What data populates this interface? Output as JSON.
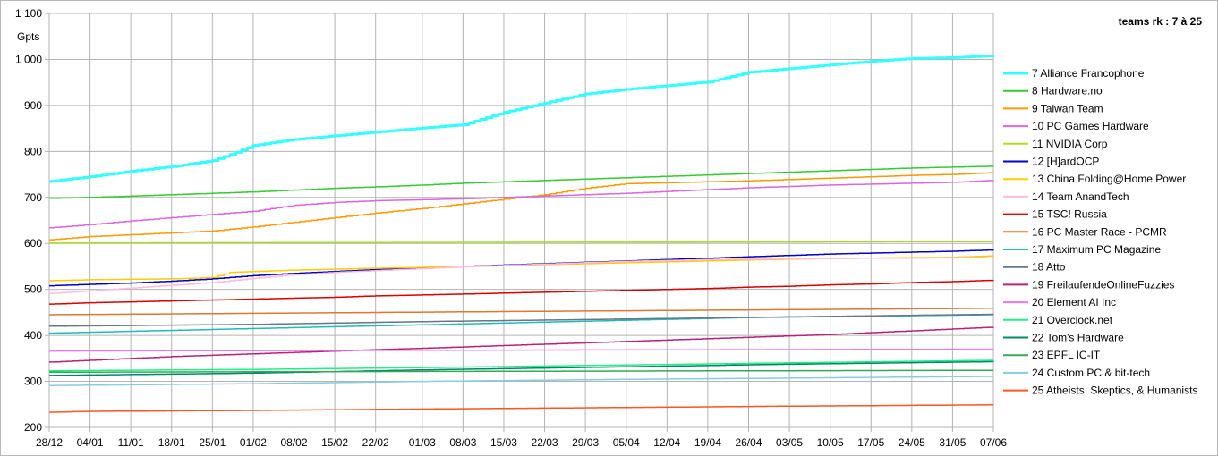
{
  "chart_data": {
    "type": "line",
    "ylabel": "Gpts",
    "legend_title": "teams rk : 7 à 25",
    "legend_position": "right",
    "grid": true,
    "ylim": [
      200,
      1100
    ],
    "yticks": [
      200,
      300,
      400,
      500,
      600,
      700,
      800,
      900,
      1000,
      1100
    ],
    "ytick_labels": [
      "200",
      "300",
      "400",
      "500",
      "600",
      "700",
      "800",
      "900",
      "1 000",
      "1 100"
    ],
    "xlim": [
      "2019-12-28",
      "2020-06-07"
    ],
    "xticks": [
      "2019-12-28",
      "2020-01-04",
      "2020-01-11",
      "2020-01-18",
      "2020-01-25",
      "2020-02-01",
      "2020-02-08",
      "2020-02-15",
      "2020-02-22",
      "2020-03-01",
      "2020-03-08",
      "2020-03-15",
      "2020-03-22",
      "2020-03-29",
      "2020-04-05",
      "2020-04-12",
      "2020-04-19",
      "2020-04-26",
      "2020-05-03",
      "2020-05-10",
      "2020-05-17",
      "2020-05-24",
      "2020-05-31",
      "2020-06-07"
    ],
    "xtick_labels": [
      "28/12",
      "04/01",
      "11/01",
      "18/01",
      "25/01",
      "01/02",
      "08/02",
      "15/02",
      "22/02",
      "01/03",
      "08/03",
      "15/03",
      "22/03",
      "29/03",
      "05/04",
      "12/04",
      "19/04",
      "26/04",
      "03/05",
      "10/05",
      "17/05",
      "24/05",
      "31/05",
      "07/06"
    ],
    "series": [
      {
        "name": "7 Alliance Francophone",
        "color": "#33ffff",
        "x": [
          "2019-12-28",
          "2020-01-04",
          "2020-01-11",
          "2020-01-18",
          "2020-01-25",
          "2020-01-29",
          "2020-02-01",
          "2020-02-08",
          "2020-02-15",
          "2020-02-22",
          "2020-03-01",
          "2020-03-08",
          "2020-03-15",
          "2020-03-22",
          "2020-03-29",
          "2020-04-05",
          "2020-04-12",
          "2020-04-19",
          "2020-04-26",
          "2020-05-03",
          "2020-05-10",
          "2020-05-17",
          "2020-05-24",
          "2020-05-31",
          "2020-06-07"
        ],
        "values": [
          735,
          745,
          757,
          767,
          780,
          798,
          813,
          826,
          834,
          842,
          851,
          858,
          885,
          905,
          925,
          935,
          943,
          951,
          972,
          980,
          988,
          996,
          1002,
          1004,
          1008
        ]
      },
      {
        "name": "8 Hardware.no",
        "color": "#33cc33",
        "x": [
          "2019-12-28",
          "2020-01-04",
          "2020-01-11",
          "2020-01-18",
          "2020-01-25",
          "2020-02-01",
          "2020-02-08",
          "2020-02-15",
          "2020-02-22",
          "2020-03-01",
          "2020-03-08",
          "2020-03-15",
          "2020-03-22",
          "2020-03-29",
          "2020-04-05",
          "2020-04-12",
          "2020-04-19",
          "2020-04-26",
          "2020-05-03",
          "2020-05-10",
          "2020-05-17",
          "2020-05-24",
          "2020-05-31",
          "2020-06-07"
        ],
        "values": [
          698,
          700,
          703,
          706,
          709,
          712,
          716,
          720,
          723,
          727,
          731,
          734,
          737,
          740,
          743,
          746,
          749,
          752,
          755,
          758,
          761,
          764,
          766,
          768
        ]
      },
      {
        "name": "9 Taiwan Team",
        "color": "#ff9900",
        "x": [
          "2019-12-28",
          "2020-01-04",
          "2020-01-11",
          "2020-01-18",
          "2020-01-25",
          "2020-02-01",
          "2020-02-08",
          "2020-02-15",
          "2020-02-22",
          "2020-03-01",
          "2020-03-08",
          "2020-03-15",
          "2020-03-22",
          "2020-03-29",
          "2020-04-05",
          "2020-04-12",
          "2020-04-19",
          "2020-04-26",
          "2020-05-03",
          "2020-05-10",
          "2020-05-17",
          "2020-05-24",
          "2020-05-31",
          "2020-06-07"
        ],
        "values": [
          608,
          615,
          619,
          623,
          627,
          636,
          646,
          656,
          666,
          676,
          686,
          696,
          706,
          720,
          730,
          732,
          734,
          736,
          739,
          742,
          745,
          748,
          750,
          754
        ]
      },
      {
        "name": "10 PC Games Hardware",
        "color": "#dd66dd",
        "x": [
          "2019-12-28",
          "2020-01-04",
          "2020-01-11",
          "2020-01-18",
          "2020-01-25",
          "2020-02-01",
          "2020-02-08",
          "2020-02-15",
          "2020-02-22",
          "2020-03-01",
          "2020-03-08",
          "2020-03-15",
          "2020-03-22",
          "2020-03-29",
          "2020-04-05",
          "2020-04-12",
          "2020-04-19",
          "2020-04-26",
          "2020-05-03",
          "2020-05-10",
          "2020-05-17",
          "2020-05-24",
          "2020-05-31",
          "2020-06-07"
        ],
        "values": [
          634,
          641,
          649,
          656,
          663,
          670,
          683,
          689,
          693,
          695,
          697,
          700,
          703,
          706,
          709,
          713,
          717,
          721,
          724,
          727,
          729,
          731,
          733,
          737
        ]
      },
      {
        "name": "11 NVIDIA Corp",
        "color": "#aadd22",
        "x": [
          "2019-12-28",
          "2020-06-07"
        ],
        "values": [
          601,
          604
        ]
      },
      {
        "name": "12 [H]ardOCP",
        "color": "#0000cc",
        "x": [
          "2019-12-28",
          "2020-01-04",
          "2020-01-11",
          "2020-01-18",
          "2020-01-25",
          "2020-02-01",
          "2020-02-08",
          "2020-02-15",
          "2020-02-22",
          "2020-03-01",
          "2020-03-08",
          "2020-03-15",
          "2020-03-22",
          "2020-03-29",
          "2020-04-05",
          "2020-04-12",
          "2020-04-19",
          "2020-04-26",
          "2020-05-03",
          "2020-05-10",
          "2020-05-17",
          "2020-05-24",
          "2020-05-31",
          "2020-06-07"
        ],
        "values": [
          508,
          511,
          514,
          518,
          523,
          530,
          535,
          539,
          543,
          547,
          550,
          553,
          556,
          559,
          562,
          565,
          568,
          571,
          574,
          577,
          579,
          581,
          583,
          586
        ]
      },
      {
        "name": "13 China Folding@Home Power",
        "color": "#ffcc00",
        "x": [
          "2019-12-28",
          "2020-01-04",
          "2020-01-11",
          "2020-01-18",
          "2020-01-21",
          "2020-01-25",
          "2020-01-28",
          "2020-02-01",
          "2020-02-08",
          "2020-02-15",
          "2020-02-22",
          "2020-03-01",
          "2020-03-08",
          "2020-03-15",
          "2020-03-22",
          "2020-03-29",
          "2020-04-05",
          "2020-04-12",
          "2020-04-19",
          "2020-04-26",
          "2020-05-03",
          "2020-05-10",
          "2020-05-17",
          "2020-05-24",
          "2020-05-31",
          "2020-06-07"
        ],
        "values": [
          519,
          521,
          522,
          523,
          524,
          526,
          537,
          539,
          542,
          544,
          546,
          548,
          550,
          552,
          554,
          556,
          558,
          560,
          562,
          564,
          566,
          567,
          568,
          569,
          570,
          573
        ]
      },
      {
        "name": "14 Team AnandTech",
        "color": "#ffbbdd",
        "x": [
          "2019-12-28",
          "2020-01-04",
          "2020-01-11",
          "2020-01-18",
          "2020-01-25",
          "2020-02-01",
          "2020-02-08",
          "2020-02-15",
          "2020-02-22",
          "2020-03-01",
          "2020-03-08",
          "2020-03-15",
          "2020-03-22",
          "2020-03-29",
          "2020-04-05",
          "2020-04-12",
          "2020-04-19",
          "2020-04-26",
          "2020-05-03",
          "2020-05-10",
          "2020-05-17",
          "2020-05-24",
          "2020-05-31",
          "2020-06-07"
        ],
        "values": [
          491,
          497,
          503,
          509,
          515,
          524,
          532,
          537,
          541,
          545,
          549,
          552,
          555,
          558,
          561,
          563,
          565,
          566,
          567,
          567,
          568,
          568,
          569,
          569
        ]
      },
      {
        "name": "15 TSC! Russia",
        "color": "#dd0000",
        "x": [
          "2019-12-28",
          "2020-01-04",
          "2020-01-11",
          "2020-01-18",
          "2020-01-25",
          "2020-02-01",
          "2020-02-08",
          "2020-02-15",
          "2020-02-22",
          "2020-03-01",
          "2020-03-08",
          "2020-03-15",
          "2020-03-22",
          "2020-03-29",
          "2020-04-05",
          "2020-04-12",
          "2020-04-19",
          "2020-04-26",
          "2020-05-03",
          "2020-05-10",
          "2020-05-17",
          "2020-05-24",
          "2020-05-31",
          "2020-06-07"
        ],
        "values": [
          468,
          471,
          473,
          475,
          477,
          479,
          481,
          483,
          486,
          488,
          490,
          492,
          494,
          496,
          498,
          500,
          502,
          505,
          507,
          510,
          512,
          515,
          517,
          520
        ]
      },
      {
        "name": "16 PC Master Race - PCMR",
        "color": "#dd7733",
        "x": [
          "2019-12-28",
          "2020-06-07"
        ],
        "values": [
          445,
          459
        ]
      },
      {
        "name": "17 Maximum PC Magazine",
        "color": "#22bbbb",
        "x": [
          "2019-12-28",
          "2020-01-04",
          "2020-01-11",
          "2020-01-18",
          "2020-01-25",
          "2020-02-01",
          "2020-02-08",
          "2020-02-15",
          "2020-02-22",
          "2020-03-01",
          "2020-03-08",
          "2020-03-15",
          "2020-03-22",
          "2020-03-29",
          "2020-04-05",
          "2020-04-12",
          "2020-04-19",
          "2020-04-26",
          "2020-05-03",
          "2020-05-10",
          "2020-05-17",
          "2020-05-24",
          "2020-05-31",
          "2020-06-07"
        ],
        "values": [
          405,
          407,
          409,
          411,
          413,
          415,
          417,
          419,
          421,
          423,
          425,
          427,
          429,
          431,
          433,
          435,
          437,
          439,
          440,
          441,
          442,
          443,
          444,
          445
        ]
      },
      {
        "name": "18 Atto",
        "color": "#667788",
        "x": [
          "2019-12-28",
          "2020-02-01",
          "2020-03-01",
          "2020-04-01",
          "2020-05-01",
          "2020-06-07"
        ],
        "values": [
          420,
          424,
          430,
          435,
          440,
          446
        ]
      },
      {
        "name": "19 FreilaufendeOnlineFuzzies",
        "color": "#bb2277",
        "x": [
          "2019-12-28",
          "2020-01-04",
          "2020-01-11",
          "2020-01-18",
          "2020-01-25",
          "2020-02-01",
          "2020-02-08",
          "2020-02-15",
          "2020-02-22",
          "2020-03-01",
          "2020-03-08",
          "2020-03-15",
          "2020-03-22",
          "2020-03-29",
          "2020-04-05",
          "2020-04-12",
          "2020-04-19",
          "2020-04-26",
          "2020-05-03",
          "2020-05-10",
          "2020-05-17",
          "2020-05-24",
          "2020-05-31",
          "2020-06-07"
        ],
        "values": [
          342,
          346,
          350,
          354,
          357,
          360,
          363,
          366,
          369,
          372,
          375,
          378,
          381,
          384,
          387,
          390,
          393,
          396,
          399,
          402,
          406,
          410,
          414,
          418
        ]
      },
      {
        "name": "20 Element AI Inc",
        "color": "#ee77ee",
        "x": [
          "2019-12-28",
          "2020-06-07"
        ],
        "values": [
          366,
          370
        ]
      },
      {
        "name": "21 Overclock.net",
        "color": "#22ee88",
        "x": [
          "2019-12-28",
          "2020-02-01",
          "2020-03-01",
          "2020-04-01",
          "2020-05-01",
          "2020-06-07"
        ],
        "values": [
          323,
          326,
          330,
          335,
          340,
          346
        ]
      },
      {
        "name": "22 Tom's Hardware",
        "color": "#008866",
        "x": [
          "2019-12-28",
          "2020-02-01",
          "2020-03-01",
          "2020-04-01",
          "2020-05-01",
          "2020-06-07"
        ],
        "values": [
          313,
          318,
          325,
          331,
          337,
          343
        ]
      },
      {
        "name": "23 EPFL IC-IT",
        "color": "#33aa55",
        "x": [
          "2019-12-28",
          "2020-06-07"
        ],
        "values": [
          320,
          324
        ]
      },
      {
        "name": "24 Custom PC & bit-tech",
        "color": "#88ccdd",
        "x": [
          "2019-12-28",
          "2020-02-01",
          "2020-03-01",
          "2020-04-01",
          "2020-05-01",
          "2020-06-07"
        ],
        "values": [
          291,
          295,
          300,
          304,
          307,
          311
        ]
      },
      {
        "name": "25 Atheists, Skeptics, & Humanists",
        "color": "#ff5522",
        "x": [
          "2019-12-28",
          "2020-01-04",
          "2020-02-01",
          "2020-03-01",
          "2020-04-01",
          "2020-05-01",
          "2020-06-07"
        ],
        "values": [
          233,
          235,
          237,
          240,
          243,
          246,
          249
        ]
      }
    ]
  }
}
